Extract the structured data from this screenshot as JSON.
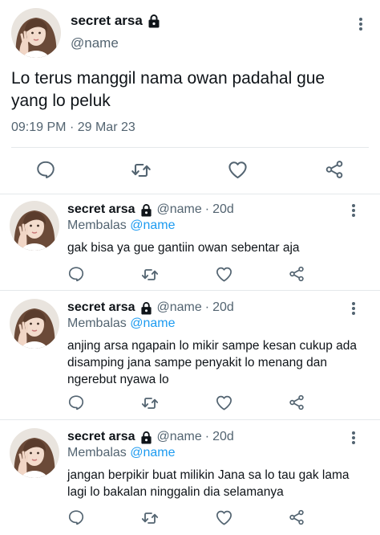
{
  "main_tweet": {
    "display_name": "secret arsa",
    "handle": "@name",
    "text": "Lo terus manggil nama owan padahal gue yang lo peluk",
    "time": "09:19 PM",
    "separator": "·",
    "date": "29 Mar 23",
    "actions": [
      "reply-icon",
      "retweet-icon",
      "like-icon",
      "share-icon"
    ]
  },
  "replies": [
    {
      "display_name": "secret arsa",
      "handle": "@name",
      "separator": "·",
      "age": "20d",
      "replying_label": "Membalas",
      "replying_to": "@name",
      "text": "gak bisa ya gue gantiin owan sebentar aja"
    },
    {
      "display_name": "secret arsa",
      "handle": "@name",
      "separator": "·",
      "age": "20d",
      "replying_label": "Membalas",
      "replying_to": "@name",
      "text": "anjing arsa ngapain lo mikir sampe kesan cukup ada disamping jana sampe penyakit lo menang dan ngerebut nyawa lo"
    },
    {
      "display_name": "secret arsa",
      "handle": "@name",
      "separator": "·",
      "age": "20d",
      "replying_label": "Membalas",
      "replying_to": "@name",
      "text": "jangan berpikir buat milikin Jana sa lo tau gak lama lagi lo bakalan ninggalin dia selamanya"
    }
  ],
  "colors": {
    "text": "#0f1419",
    "secondary": "#536471",
    "accent": "#1d9bf0",
    "divider": "#e4e8eb"
  }
}
